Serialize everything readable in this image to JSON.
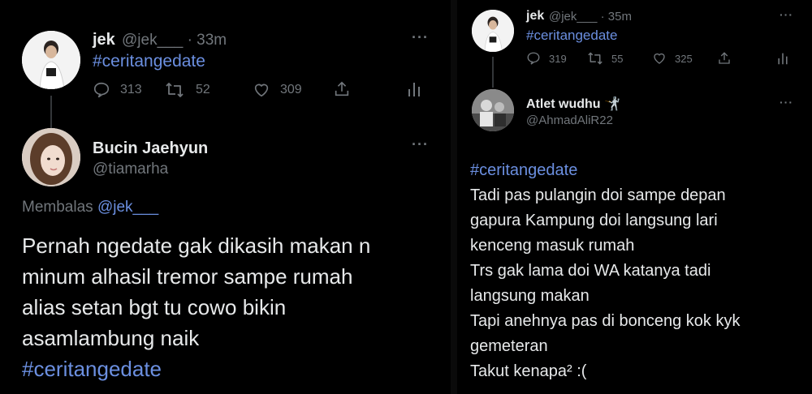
{
  "left": {
    "parent": {
      "name": "jek",
      "handle": "@jek___",
      "sep": "·",
      "time": "33m",
      "text": "#ceritangedate",
      "replies": "313",
      "retweets": "52",
      "likes": "309"
    },
    "reply": {
      "name": "Bucin Jaehyun",
      "handle": "@tiamarha",
      "replying_label": "Membalas",
      "replying_to": "@jek___",
      "lines": [
        "Pernah ngedate gak dikasih makan n",
        "minum alhasil tremor sampe rumah",
        "alias setan bgt tu cowo bikin",
        "asamlambung naik"
      ],
      "hashtag": "#ceritangedate"
    }
  },
  "right": {
    "parent": {
      "name": "jek",
      "handle": "@jek___",
      "sep": "·",
      "time": "35m",
      "text": "#ceritangedate",
      "replies": "319",
      "retweets": "55",
      "likes": "325"
    },
    "reply": {
      "name": "Atlet wudhu",
      "name_emoji": "🤺",
      "handle": "@AhmadAliR22",
      "hashtag": "#ceritangedate",
      "lines": [
        "Tadi pas pulangin doi sampe depan",
        "gapura Kampung doi langsung lari",
        "kenceng masuk rumah",
        "Trs gak lama doi WA katanya tadi",
        "langsung makan",
        "Tapi anehnya pas di bonceng kok kyk",
        "gemeteran",
        "Takut kenapa² :("
      ]
    }
  },
  "icons": {
    "more": "more-icon",
    "reply": "reply-icon",
    "retweet": "retweet-icon",
    "like": "heart-icon",
    "share": "share-icon",
    "analytics": "analytics-icon"
  },
  "colors": {
    "background": "#000000",
    "text": "#e7e9ea",
    "secondary": "#71767b",
    "link": "#6b8fe0"
  }
}
